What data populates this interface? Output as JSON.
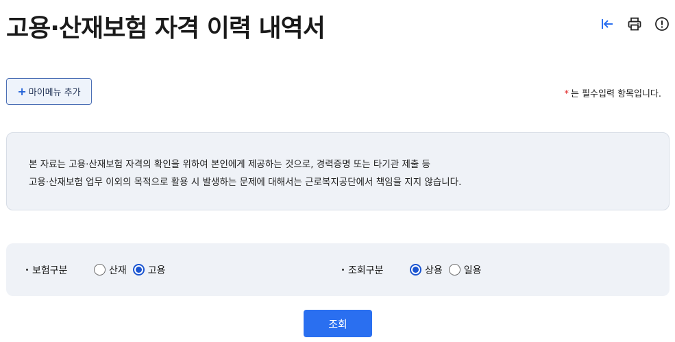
{
  "page": {
    "title": "고용·산재보험 자격 이력 내역서"
  },
  "toolbar": {
    "collapse_icon": "collapse-left-icon",
    "print_icon": "printer-icon",
    "info_icon": "info-icon"
  },
  "my_menu": {
    "plus": "+",
    "label": "마이메뉴 추가"
  },
  "required_note": {
    "star": "*",
    "text": "는 필수입력 항목입니다."
  },
  "notice": {
    "line1": "본 자료는 고용·산재보험 자격의 확인을 위하여 본인에게 제공하는 것으로, 경력증명 또는 타기관 제출 등",
    "line2": "고용·산재보험 업무 이외의 목적으로 활용 시 발생하는 문제에 대해서는 근로복지공단에서 책임을 지지 않습니다."
  },
  "filters": {
    "insurance_type": {
      "label": "보험구분",
      "options": [
        {
          "label": "산재",
          "selected": false
        },
        {
          "label": "고용",
          "selected": true
        }
      ]
    },
    "inquiry_type": {
      "label": "조회구분",
      "options": [
        {
          "label": "상용",
          "selected": true
        },
        {
          "label": "일용",
          "selected": false
        }
      ]
    }
  },
  "search_button": {
    "label": "조회"
  },
  "colors": {
    "primary": "#2a6ff0",
    "radio_checked": "#1b55d1",
    "required_star": "#e02020",
    "panel_bg": "#eff2f7"
  }
}
